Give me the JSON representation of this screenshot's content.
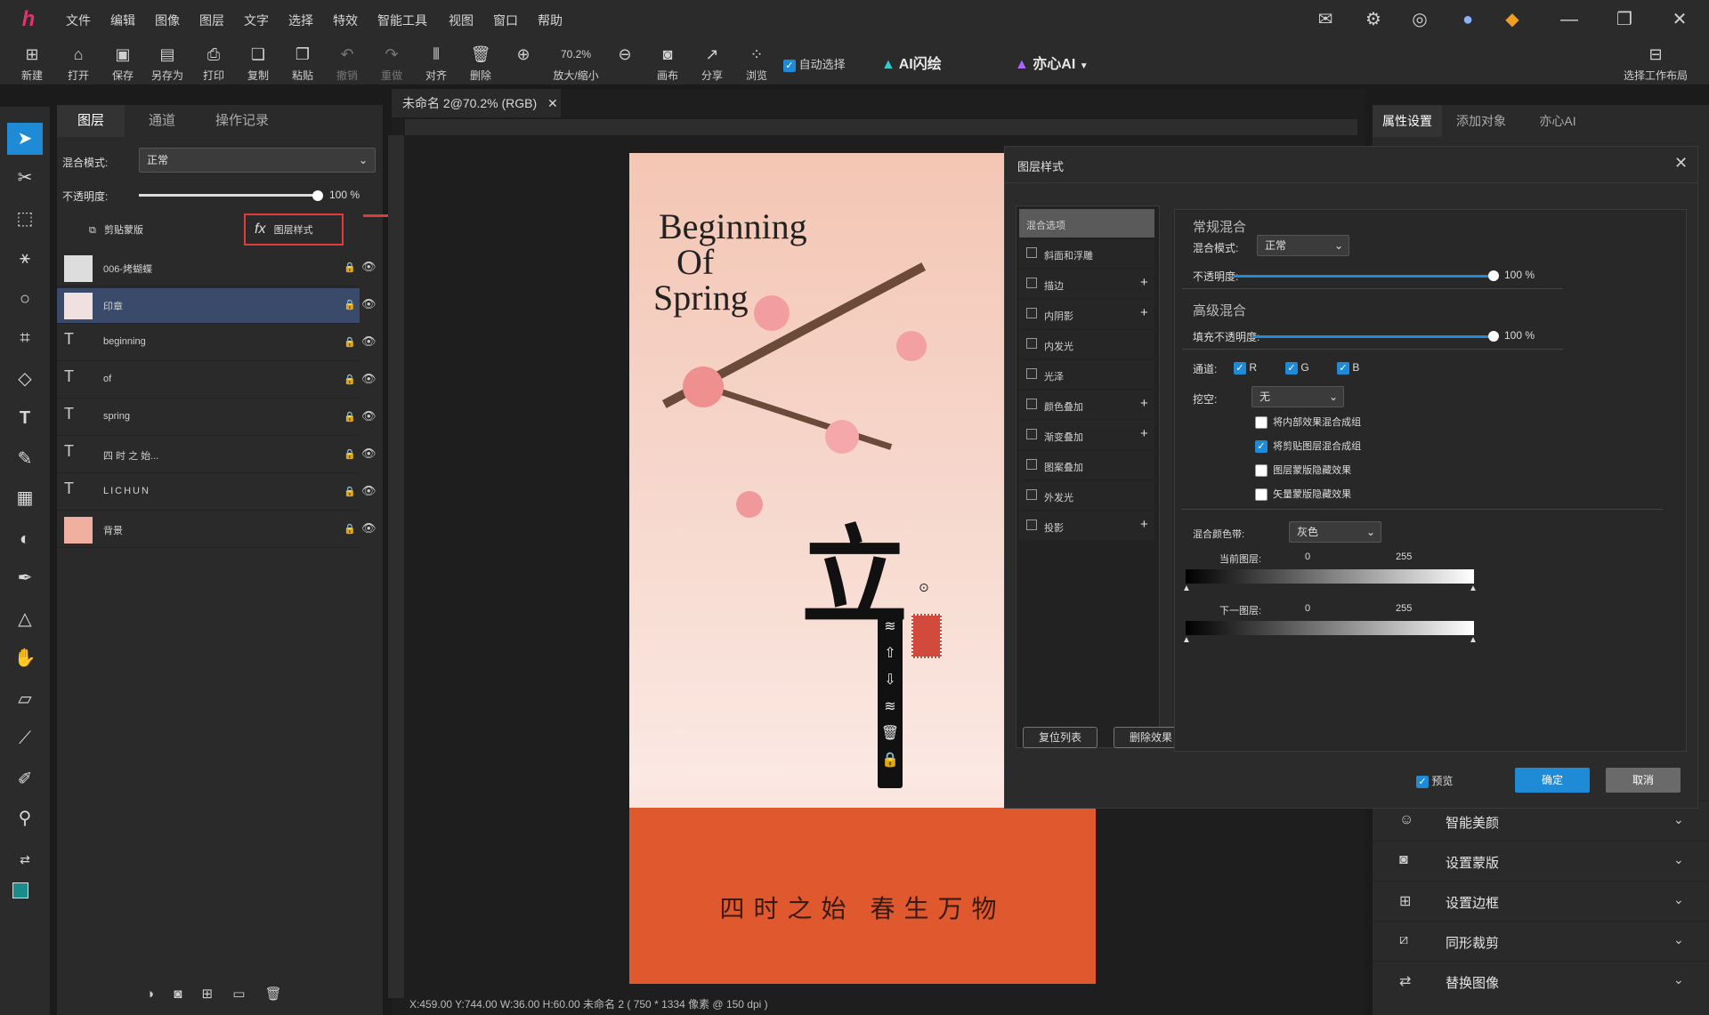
{
  "menubar": {
    "logo": "h",
    "items": [
      "文件",
      "编辑",
      "图像",
      "图层",
      "文字",
      "选择",
      "特效",
      "智能工具",
      "视图",
      "窗口",
      "帮助"
    ]
  },
  "toolbar": {
    "items": [
      "新建",
      "打开",
      "保存",
      "另存为",
      "打印",
      "复制",
      "粘贴",
      "撤销",
      "重做",
      "对齐",
      "删除"
    ],
    "zoom_label": "放大/缩小",
    "zoom_value": "70.2%",
    "canvas": "画布",
    "share": "分享",
    "browse": "浏览",
    "auto_select": "自动选择",
    "ai_flash": "AI闪绘",
    "ai_yixin": "亦心AI",
    "workspace": "选择工作布局"
  },
  "layers_panel": {
    "tabs": [
      "图层",
      "通道",
      "操作记录"
    ],
    "blend_label": "混合模式:",
    "blend_value": "正常",
    "opacity_label": "不透明度:",
    "opacity_value": "100",
    "opacity_unit": "%",
    "clip_mask": "剪贴蒙版",
    "layer_style": "图层样式",
    "layers": [
      {
        "name": "006-烤蝴蝶",
        "type": "image"
      },
      {
        "name": "印章",
        "type": "image"
      },
      {
        "name": "beginning",
        "type": "text"
      },
      {
        "name": "of",
        "type": "text"
      },
      {
        "name": "spring",
        "type": "text"
      },
      {
        "name": "四 时 之 始...",
        "type": "text"
      },
      {
        "name": "LICHUN",
        "type": "text"
      },
      {
        "name": "背景",
        "type": "image"
      }
    ]
  },
  "document": {
    "tab": "未命名 2@70.2% (RGB)",
    "status": "X:459.00 Y:744.00 W:36.00 H:60.00   未命名 2 ( 750 * 1334 像素 @ 150 dpi )"
  },
  "poster": {
    "title_lines": [
      "Beginning",
      "Of",
      "Spring"
    ],
    "calligraphy": "立",
    "subtitle": "四时之始 春生万物"
  },
  "dialog": {
    "title": "图层样式",
    "styles": [
      {
        "label": "混合选项",
        "checkbox": false,
        "plus": false
      },
      {
        "label": "斜面和浮雕",
        "checkbox": true,
        "plus": false
      },
      {
        "label": "描边",
        "checkbox": true,
        "plus": true
      },
      {
        "label": "内阴影",
        "checkbox": true,
        "plus": true
      },
      {
        "label": "内发光",
        "checkbox": true,
        "plus": false
      },
      {
        "label": "光泽",
        "checkbox": true,
        "plus": false
      },
      {
        "label": "颜色叠加",
        "checkbox": true,
        "plus": true
      },
      {
        "label": "渐变叠加",
        "checkbox": true,
        "plus": true
      },
      {
        "label": "图案叠加",
        "checkbox": true,
        "plus": false
      },
      {
        "label": "外发光",
        "checkbox": true,
        "plus": false
      },
      {
        "label": "投影",
        "checkbox": true,
        "plus": true
      }
    ],
    "reset_list": "复位列表",
    "delete_effect": "删除效果",
    "general_blend": "常规混合",
    "blend_mode_label": "混合模式:",
    "blend_mode": "正常",
    "opacity_label": "不透明度:",
    "opacity": "100",
    "unit": "%",
    "advanced_blend": "高级混合",
    "fill_opacity_label": "填充不透明度:",
    "fill_opacity": "100",
    "channels_label": "通道:",
    "channels": [
      "R",
      "G",
      "B"
    ],
    "knockout_label": "挖空:",
    "knockout": "无",
    "options": [
      {
        "label": "将内部效果混合成组",
        "checked": false
      },
      {
        "label": "将剪贴图层混合成组",
        "checked": true
      },
      {
        "label": "图层蒙版隐藏效果",
        "checked": false
      },
      {
        "label": "矢量蒙版隐藏效果",
        "checked": false
      }
    ],
    "blend_if_label": "混合颜色带:",
    "blend_if": "灰色",
    "current_layer": "当前图层:",
    "underlying_layer": "下一图层:",
    "range_min": "0",
    "range_max": "255",
    "preview": "预览",
    "ok": "确定",
    "cancel": "取消"
  },
  "right_panel": {
    "tabs": [
      "属性设置",
      "添加对象",
      "亦心AI"
    ],
    "accordions": [
      "智能美颜",
      "设置蒙版",
      "设置边框",
      "同形裁剪",
      "替换图像"
    ]
  }
}
